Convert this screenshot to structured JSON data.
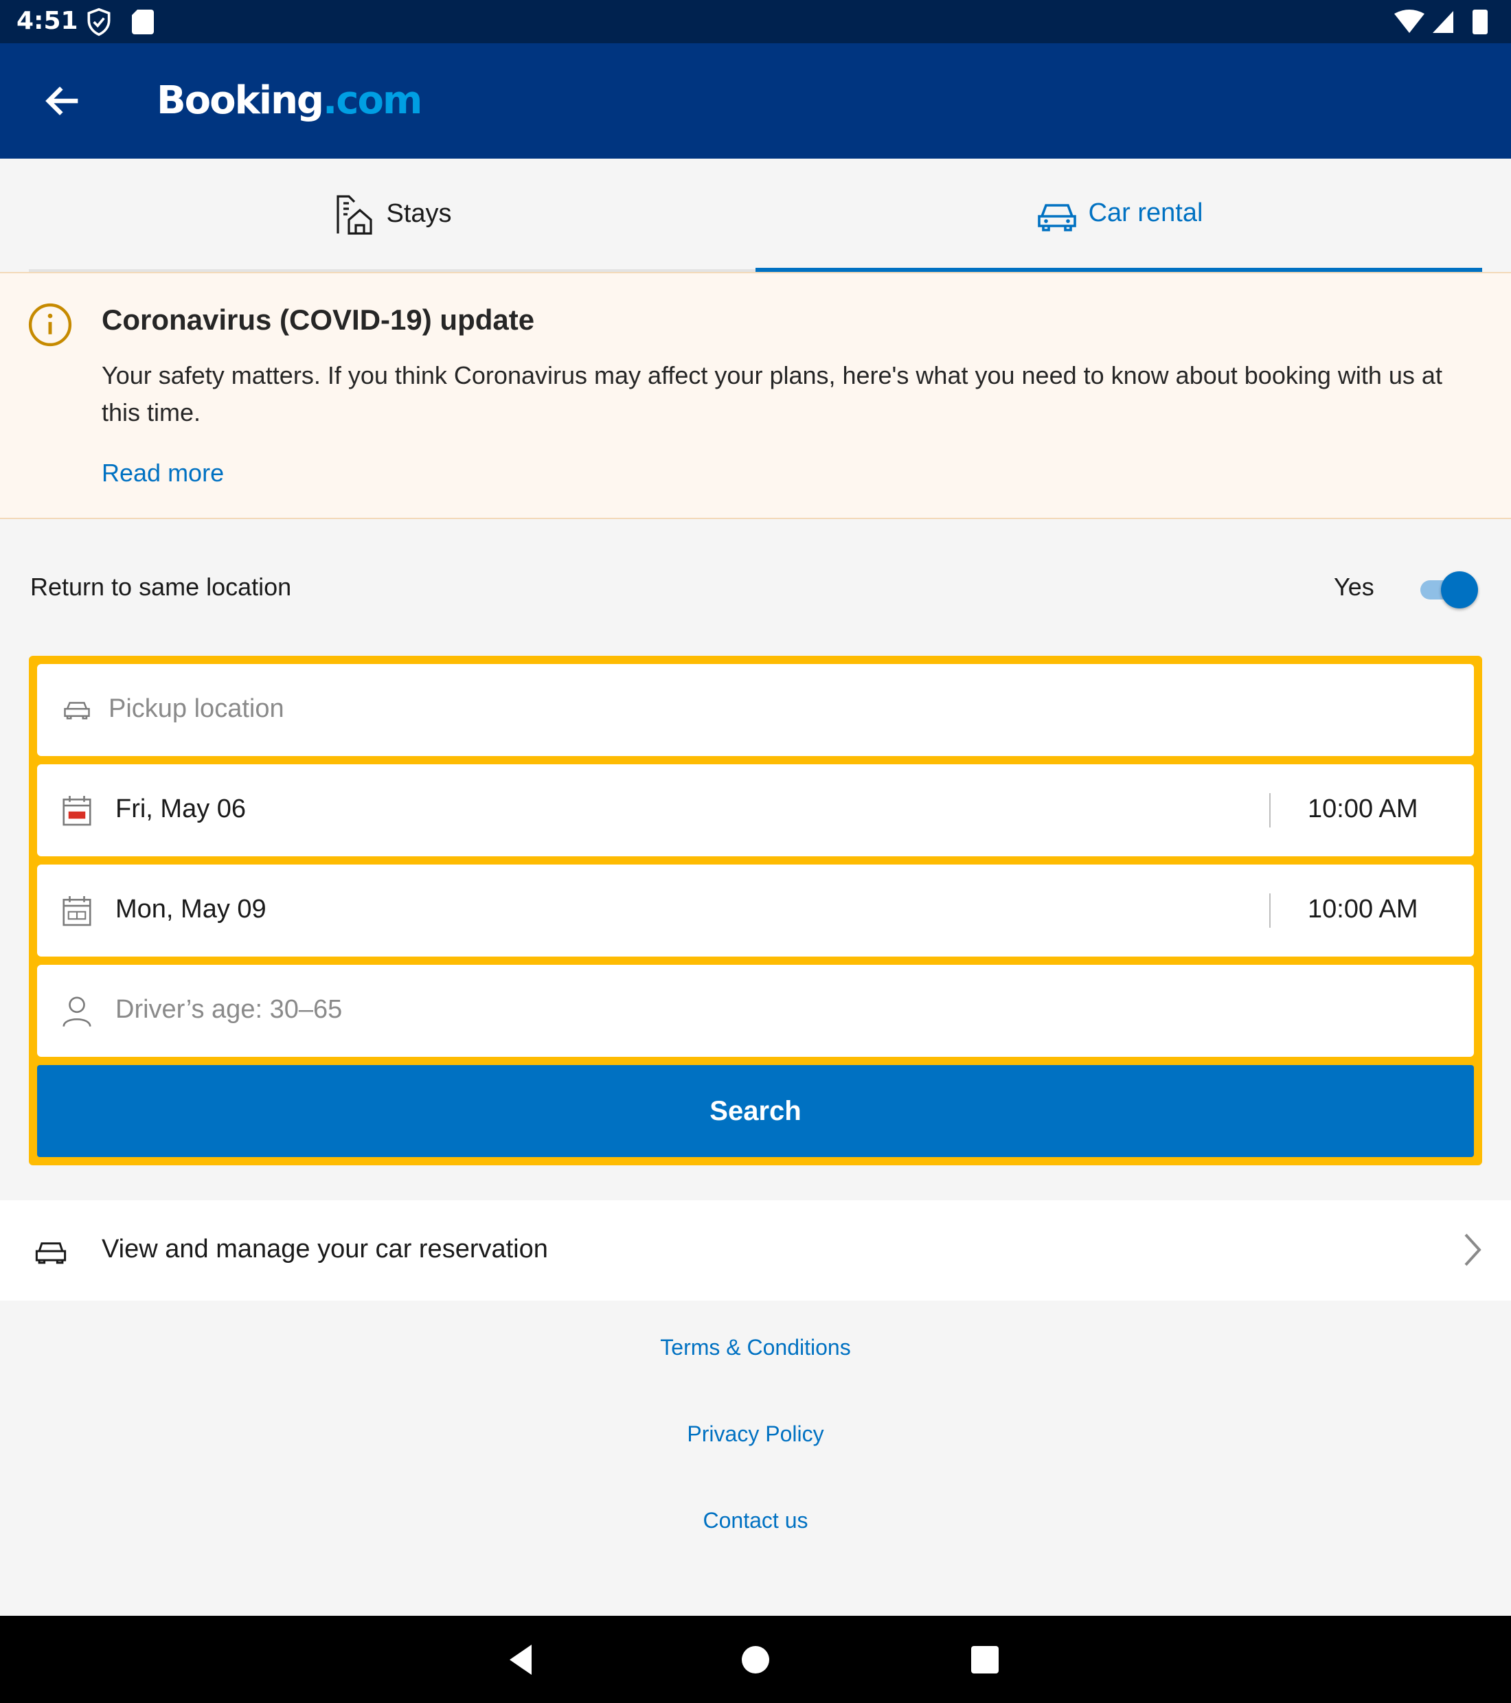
{
  "status_bar": {
    "time": "4:51"
  },
  "app_bar": {
    "logo_main": "Booking",
    "logo_dot": ".com"
  },
  "tabs": [
    {
      "label": "Stays",
      "icon": "stays-icon",
      "selected": false
    },
    {
      "label": "Car rental",
      "icon": "car-icon",
      "selected": true
    }
  ],
  "covid": {
    "title": "Coronavirus (COVID-19) update",
    "text": "Your safety matters. If you think Coronavirus may affect your plans, here's what you need to know about booking with us at this time.",
    "link": "Read more"
  },
  "return_location": {
    "label": "Return to same location",
    "value": "Yes",
    "enabled": true
  },
  "search_form": {
    "pickup_placeholder": "Pickup location",
    "pickup_date": "Fri, May 06",
    "pickup_time": "10:00 AM",
    "dropoff_date": "Mon, May 09",
    "dropoff_time": "10:00 AM",
    "driver_age": "Driver’s age: 30–65",
    "search_label": "Search"
  },
  "manage": {
    "label": "View and manage your car reservation"
  },
  "footer": {
    "terms": "Terms & Conditions",
    "privacy": "Privacy Policy",
    "contact": "Contact us"
  },
  "colors": {
    "brand": "#003580",
    "accent": "#0071c2",
    "search_border": "#febb02",
    "logo_dot": "#009fe3"
  }
}
